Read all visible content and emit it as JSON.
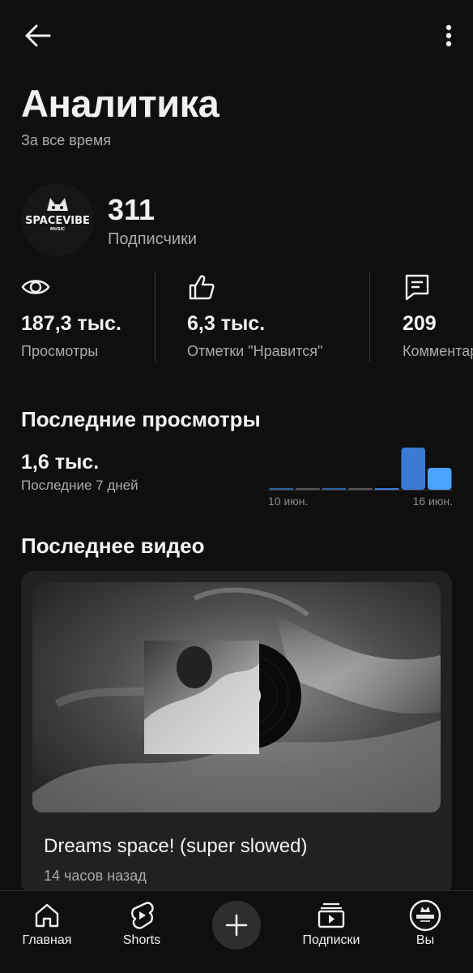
{
  "header": {
    "title": "Аналитика",
    "subtitle": "За все время"
  },
  "channel": {
    "avatar_text": "SPACEVIBE",
    "avatar_subtext": "MUSIC",
    "subscribers_value": "311",
    "subscribers_label": "Подписчики"
  },
  "stats": [
    {
      "icon": "eye-icon",
      "value": "187,3 тыс.",
      "label": "Просмотры"
    },
    {
      "icon": "thumbs-up-icon",
      "value": "6,3 тыс.",
      "label": "Отметки \"Нравится\""
    },
    {
      "icon": "comment-icon",
      "value": "209",
      "label": "Комментарии"
    }
  ],
  "recent_views": {
    "title": "Последние просмотры",
    "value": "1,6 тыс.",
    "period": "Последние 7 дней",
    "chart_data": {
      "type": "bar",
      "values": [
        0.02,
        0.02,
        0.02,
        0.02,
        0.02,
        1.0,
        0.52
      ],
      "start_label": "10 июн.",
      "end_label": "16 июн."
    }
  },
  "latest_video": {
    "section_title": "Последнее видео",
    "title": "Dreams space! (super slowed)",
    "age": "14 часов назад"
  },
  "bottom_nav": {
    "home": "Главная",
    "shorts": "Shorts",
    "subscriptions": "Подписки",
    "you": "Вы"
  },
  "colors": {
    "background": "#0f0f0f",
    "card": "#212121",
    "muted_text": "#aaaaaa",
    "bar_blue_dark": "#3a7bd5",
    "bar_blue_light": "#4aa3ff"
  }
}
